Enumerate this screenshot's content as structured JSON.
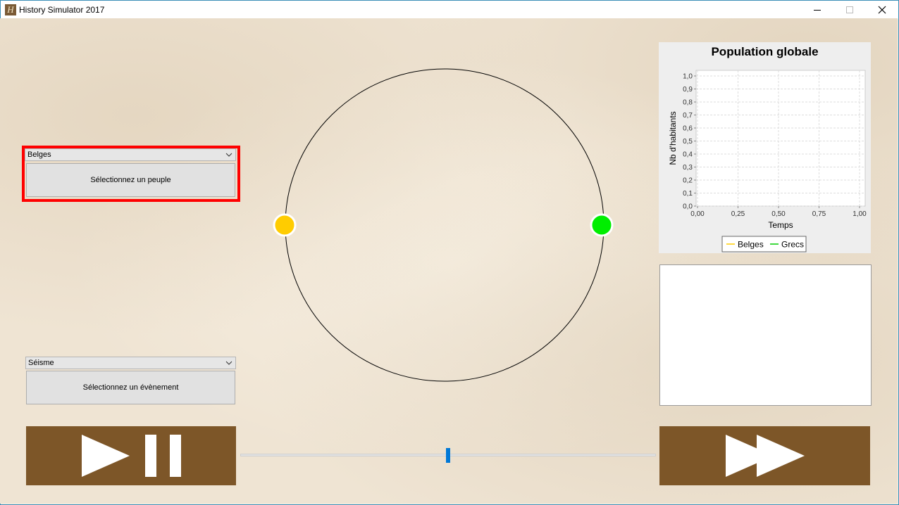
{
  "window": {
    "title": "History Simulator 2017",
    "icon_glyph": "H"
  },
  "people": {
    "selected": "Belges",
    "button_label": "Sélectionnez un peuple"
  },
  "event": {
    "selected": "Séisme",
    "button_label": "Sélectionnez un évènement"
  },
  "map": {
    "nodes": [
      {
        "name": "Belges",
        "color": "#ffcc00"
      },
      {
        "name": "Grecs",
        "color": "#00ee00"
      }
    ]
  },
  "chart_data": {
    "type": "line",
    "title": "Population globale",
    "xlabel": "Temps",
    "ylabel": "Nb d'habitants",
    "xlim": [
      0,
      1
    ],
    "ylim": [
      0,
      1
    ],
    "x_ticks": [
      "0,00",
      "0,25",
      "0,50",
      "0,75",
      "1,00"
    ],
    "y_ticks": [
      "0,0",
      "0,1",
      "0,2",
      "0,3",
      "0,4",
      "0,5",
      "0,6",
      "0,7",
      "0,8",
      "0,9",
      "1,0"
    ],
    "grid": true,
    "legend_position": "bottom",
    "series": [
      {
        "name": "Belges",
        "color": "#ffcc00",
        "values": []
      },
      {
        "name": "Grecs",
        "color": "#00cc00",
        "values": []
      }
    ]
  },
  "controls": {
    "play_pause_icon": "play-pause-icon",
    "fast_forward_icon": "fast-forward-icon",
    "speed_slider_value": 0.5,
    "button_color": "#7d5628"
  }
}
